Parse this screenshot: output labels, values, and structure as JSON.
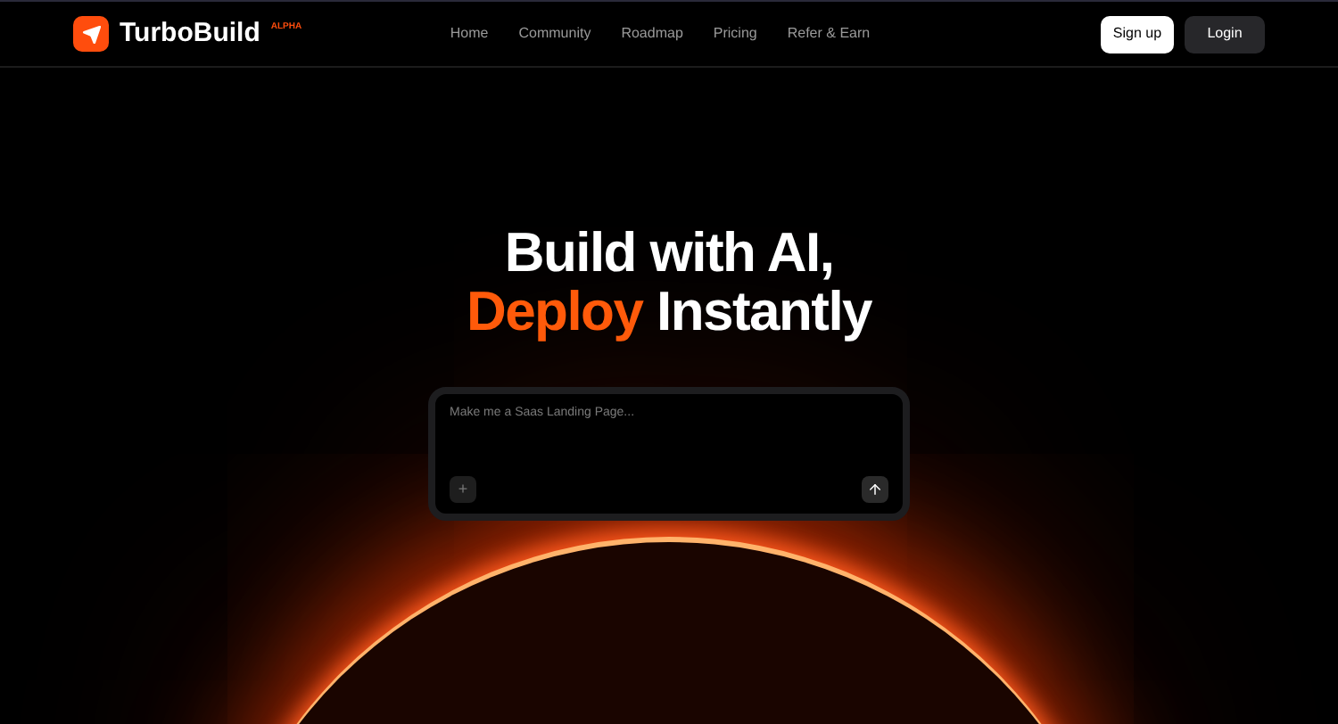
{
  "brand": {
    "name": "TurboBuild",
    "badge": "ALPHA"
  },
  "nav": [
    "Home",
    "Community",
    "Roadmap",
    "Pricing",
    "Refer & Earn"
  ],
  "actions": [
    {
      "label": "Sign up",
      "kind": "light"
    },
    {
      "label": "Login",
      "kind": "dark"
    }
  ],
  "hero": {
    "line_1": "Build with AI,",
    "highlight": "Deploy",
    "line_2_rest": "Instantly"
  },
  "prompt": {
    "placeholder": "Make me a Saas Landing Page...",
    "attach": "+"
  }
}
